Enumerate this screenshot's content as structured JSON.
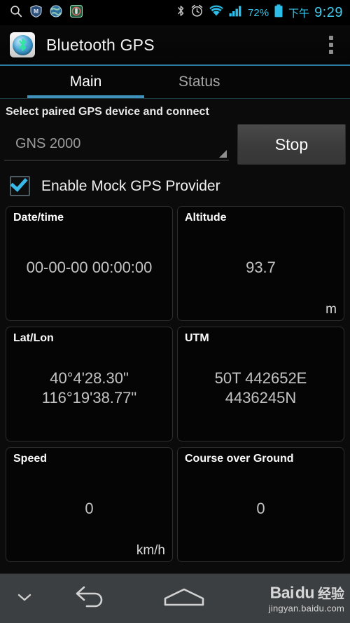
{
  "status_bar": {
    "left_icons": [
      "search-icon",
      "shield-m-icon",
      "globe-icon",
      "app-green-icon"
    ],
    "right_icons": [
      "bluetooth-icon",
      "alarm-clock-icon",
      "wifi-icon",
      "signal-bars-icon"
    ],
    "battery_percent": "72%",
    "am_pm": "下午",
    "clock": "9:29",
    "accent_color": "#35c3e8"
  },
  "action_bar": {
    "app_icon": "bluetooth-gps-app-icon",
    "title": "Bluetooth GPS",
    "overflow_label": "overflow-menu"
  },
  "tabs": [
    {
      "label": "Main",
      "active": true
    },
    {
      "label": "Status",
      "active": false
    }
  ],
  "tab_indicator_color": "#3e92bb",
  "main": {
    "section_label": "Select paired GPS device and connect",
    "device_spinner": {
      "value": "GNS 2000",
      "placeholder": "GNS 2000"
    },
    "connect_button": "Stop",
    "mock_provider": {
      "label": "Enable Mock GPS Provider",
      "checked": true,
      "check_color": "#39b9e8"
    },
    "cards": [
      {
        "title": "Date/time",
        "value": "00-00-00 00:00:00",
        "value2": "",
        "unit": ""
      },
      {
        "title": "Altitude",
        "value": "93.7",
        "value2": "",
        "unit": "m"
      },
      {
        "title": "Lat/Lon",
        "value": "40°4'28.30\"",
        "value2": "116°19'38.77\"",
        "unit": ""
      },
      {
        "title": "UTM",
        "value": "50T 442652E",
        "value2": "4436245N",
        "unit": ""
      },
      {
        "title": "Speed",
        "value": "0",
        "value2": "",
        "unit": "km/h"
      },
      {
        "title": "Course over Ground",
        "value": "0",
        "value2": "",
        "unit": ""
      }
    ]
  },
  "nav_bar": {
    "hide_keyboard": "chevron-down-icon",
    "back": "back-icon",
    "home": "home-icon",
    "watermark_brand": "Bai",
    "watermark_du": "du",
    "watermark_cn": "经验",
    "watermark_url": "jingyan.baidu.com"
  }
}
